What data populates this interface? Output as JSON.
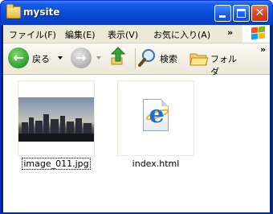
{
  "window": {
    "title": "mysite"
  },
  "menu": {
    "items": [
      "ファイル(F)",
      "編集(E)",
      "表示(V)",
      "お気に入り(A)"
    ],
    "overflow": "»"
  },
  "toolbar": {
    "back_label": "戻る",
    "search_label": "検索",
    "folders_label": "フォルダ",
    "overflow": "»"
  },
  "files": [
    {
      "name": "image_011.jpg",
      "type": "image",
      "selected": true
    },
    {
      "name": "index.html",
      "type": "html",
      "selected": false
    }
  ],
  "colors": {
    "titlebar": "#0a50d8",
    "close": "#d9421e",
    "back": "#3aa23a",
    "forward": "#a8a8a8"
  }
}
